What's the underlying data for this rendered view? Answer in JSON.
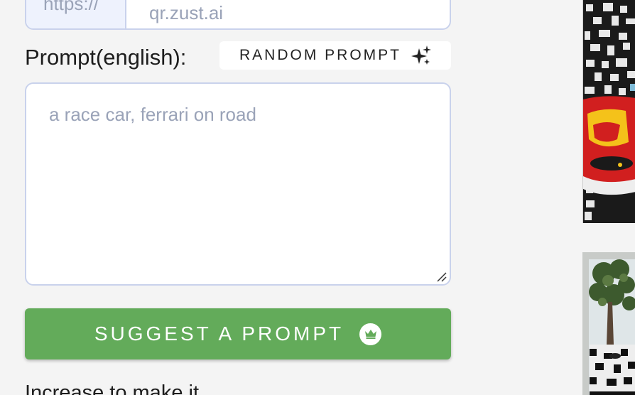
{
  "url_field": {
    "prefix": "https://",
    "value": "qr.zust.ai"
  },
  "prompt": {
    "label": "Prompt(english):",
    "random_button_label": "RANDOM PROMPT",
    "random_button_icon": "sparkles-icon",
    "placeholder": "a race car, ferrari on road",
    "value": ""
  },
  "suggest_button": {
    "label": "SUGGEST A PROMPT",
    "icon": "crown-icon",
    "color": "#63ab5a"
  },
  "next_section_text": "Increase to make it",
  "colors": {
    "input_border": "#c9d2ec",
    "prefix_bg": "#eef2fd",
    "placeholder": "#9aa3b8",
    "page_bg": "#f4f4f4"
  },
  "previews": [
    {
      "name": "qr-preview-race-car"
    },
    {
      "name": "qr-preview-tree"
    }
  ]
}
